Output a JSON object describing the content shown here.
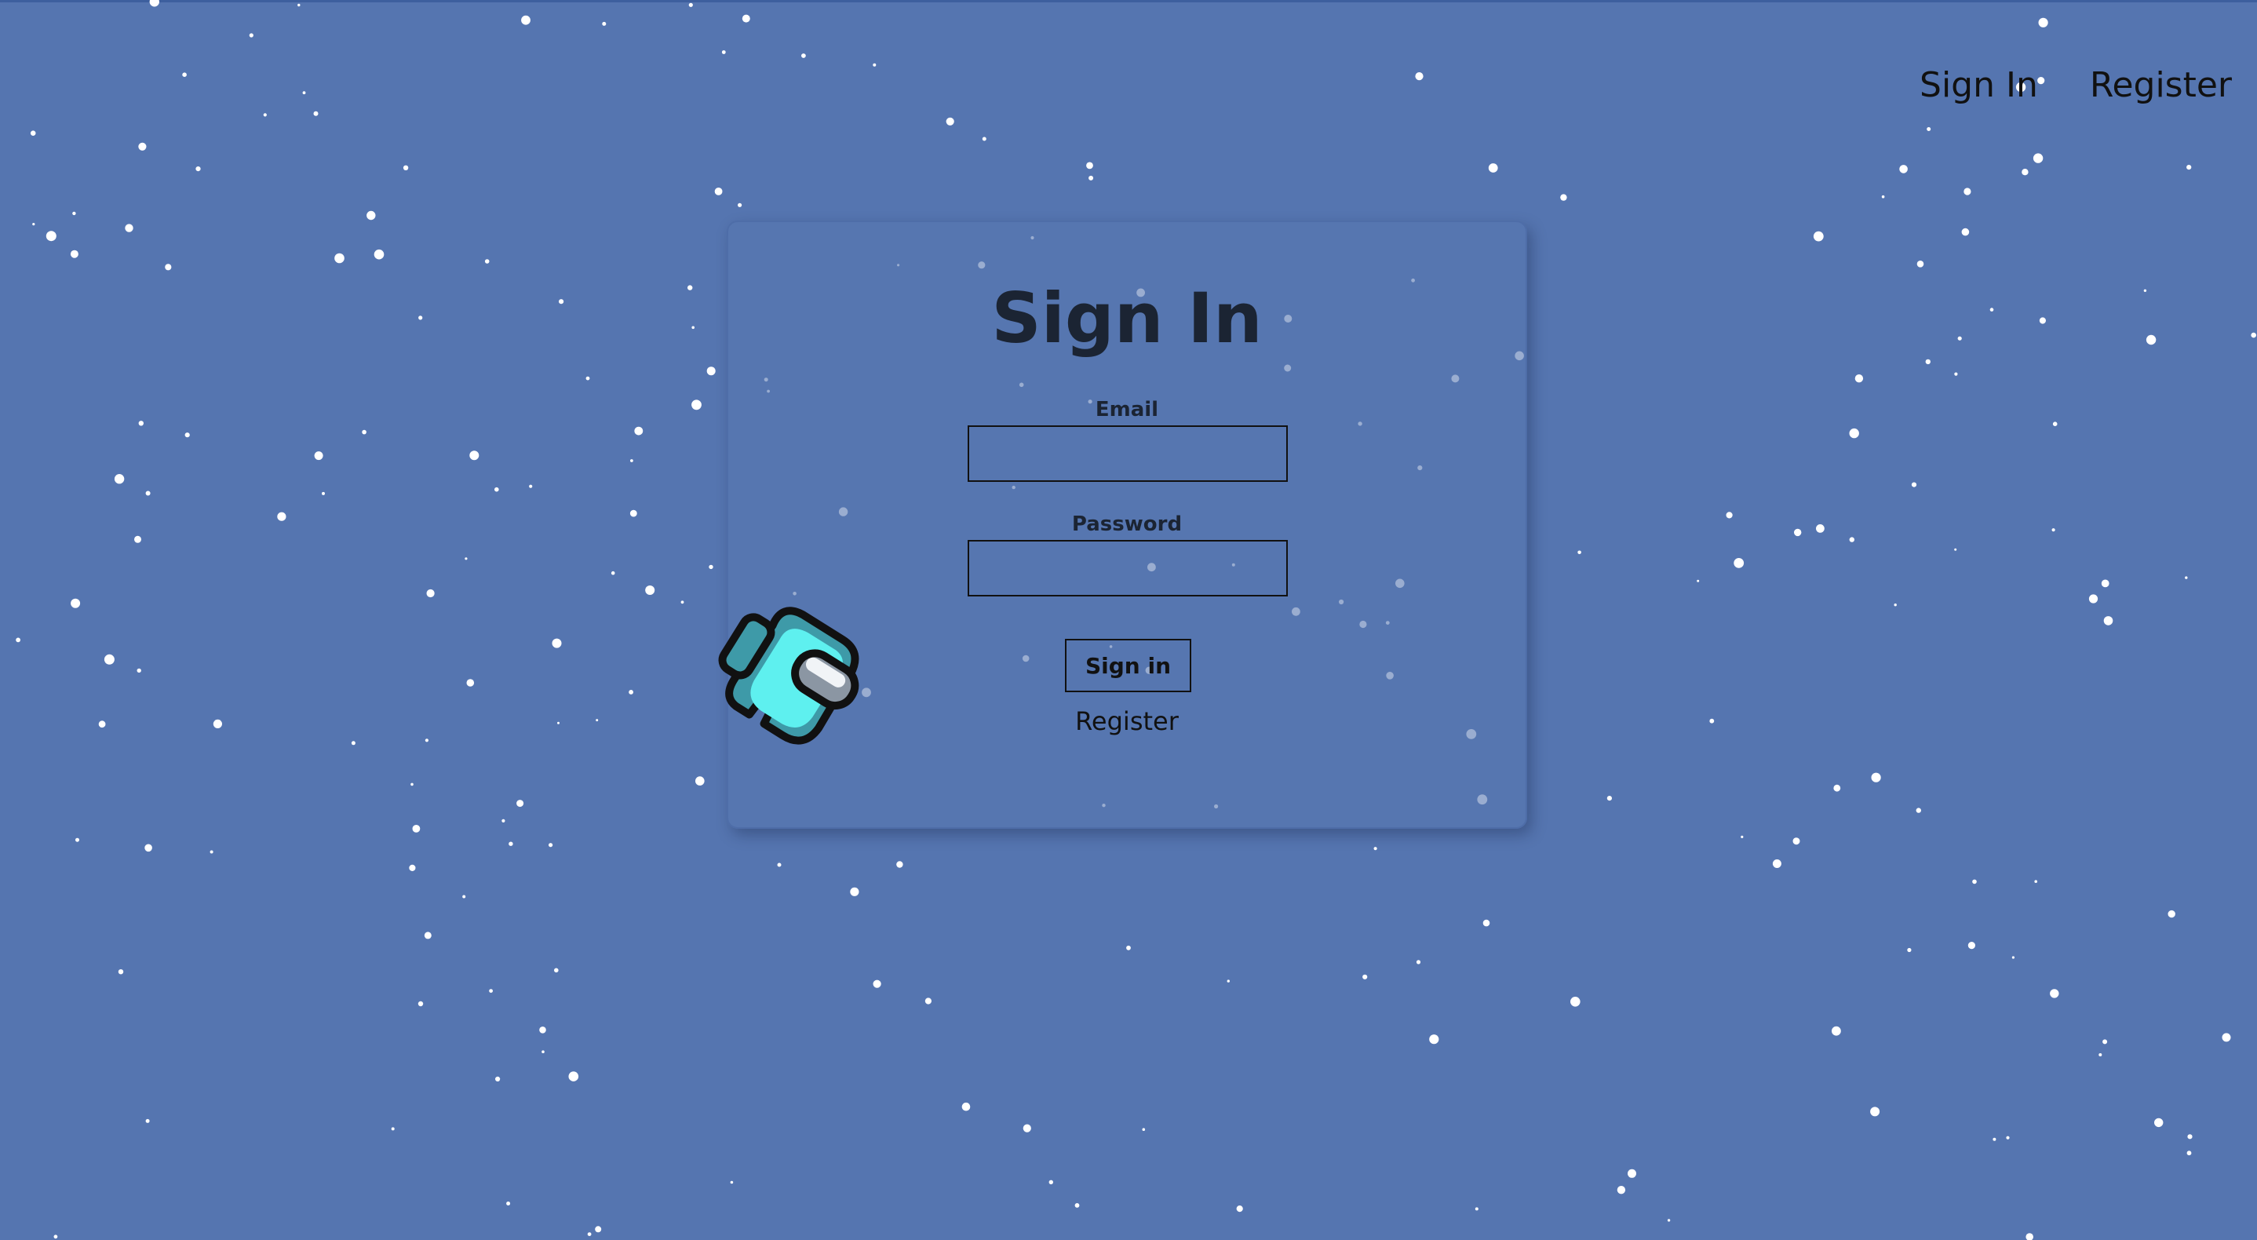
{
  "nav": {
    "sign_in": "Sign In",
    "register": "Register"
  },
  "form": {
    "title": "Sign In",
    "email_label": "Email",
    "email_value": "",
    "password_label": "Password",
    "password_value": "",
    "submit_label": "Sign in",
    "register_link": "Register"
  },
  "icons": {
    "mascot": "crewmate-icon",
    "background": "star-icon"
  },
  "colors": {
    "background": "#5575b0",
    "text": "#1b2433",
    "star": "#ffffff",
    "mascot_body": "#4fdde0",
    "mascot_visor": "#8b96a3"
  }
}
